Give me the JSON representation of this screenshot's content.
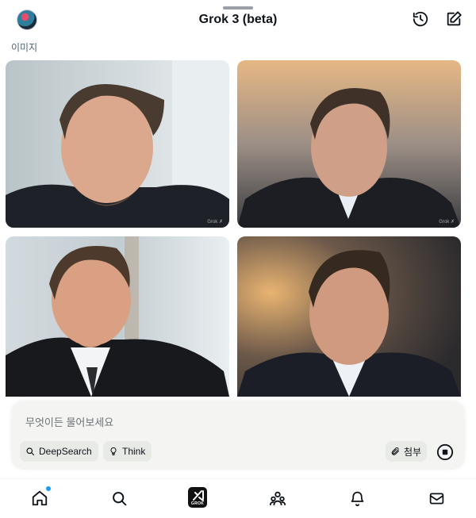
{
  "header": {
    "title": "Grok 3 (beta)",
    "icons": [
      "avatar",
      "history-icon",
      "new-chat-icon"
    ]
  },
  "section": {
    "label": "이미지"
  },
  "images": [
    {
      "watermark": "Grok ✗"
    },
    {
      "watermark": "Grok ✗"
    },
    {
      "watermark": ""
    },
    {
      "watermark": ""
    }
  ],
  "composer": {
    "placeholder": "무엇이든 물어보세요",
    "deepsearch_label": "DeepSearch",
    "think_label": "Think",
    "attach_label": "첨부"
  },
  "nav": {
    "items": [
      "home-icon",
      "search-icon",
      "grok-icon",
      "communities-icon",
      "notifications-icon",
      "messages-icon"
    ],
    "grok_text": "GROK"
  },
  "colors": {
    "accent": "#1d9bf0",
    "background": "#ffffff",
    "composer_bg": "#f4f5f3"
  }
}
